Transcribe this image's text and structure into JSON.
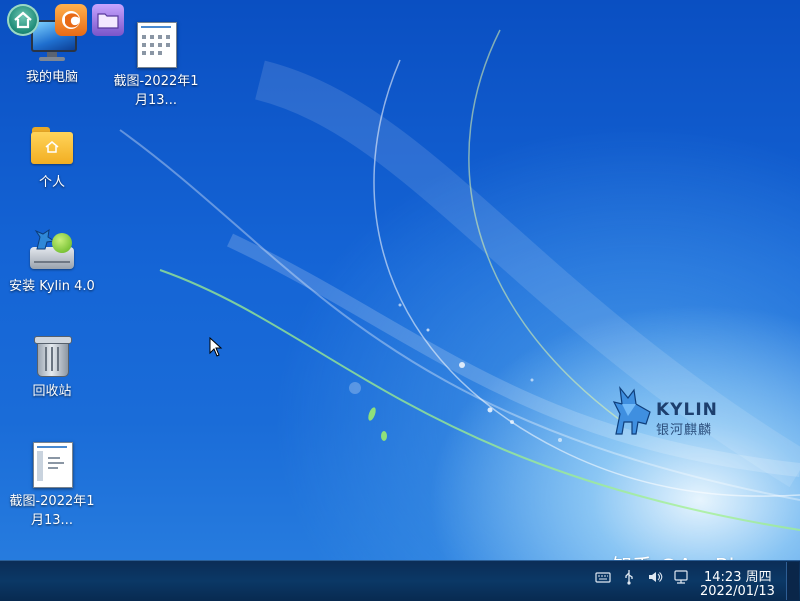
{
  "desktop": {
    "icons": [
      {
        "label": "我的电脑"
      },
      {
        "label": "个人"
      },
      {
        "label": "安装 Kylin 4.0"
      },
      {
        "label": "回收站"
      },
      {
        "label": "截图-2022年1月13..."
      },
      {
        "label": "截图-2022年1月13..."
      }
    ]
  },
  "wallpaper": {
    "logo_title": "KYLIN",
    "logo_subtitle": "银河麒麟"
  },
  "watermark": "知乎 @AceBing",
  "taskbar": {
    "start_icon": "home-icon",
    "apps": [
      "browser-icon",
      "file-manager-icon"
    ],
    "tray_icons": [
      "keyboard-icon",
      "usb-icon",
      "volume-icon",
      "network-icon"
    ],
    "time": "14:23 周四",
    "date": "2022/01/13"
  },
  "colors": {
    "desktop_blue": "#1565d6",
    "taskbar_bg": "#0b3866",
    "folder_yellow": "#f2ae22",
    "start_orb": "#1f8c78"
  }
}
